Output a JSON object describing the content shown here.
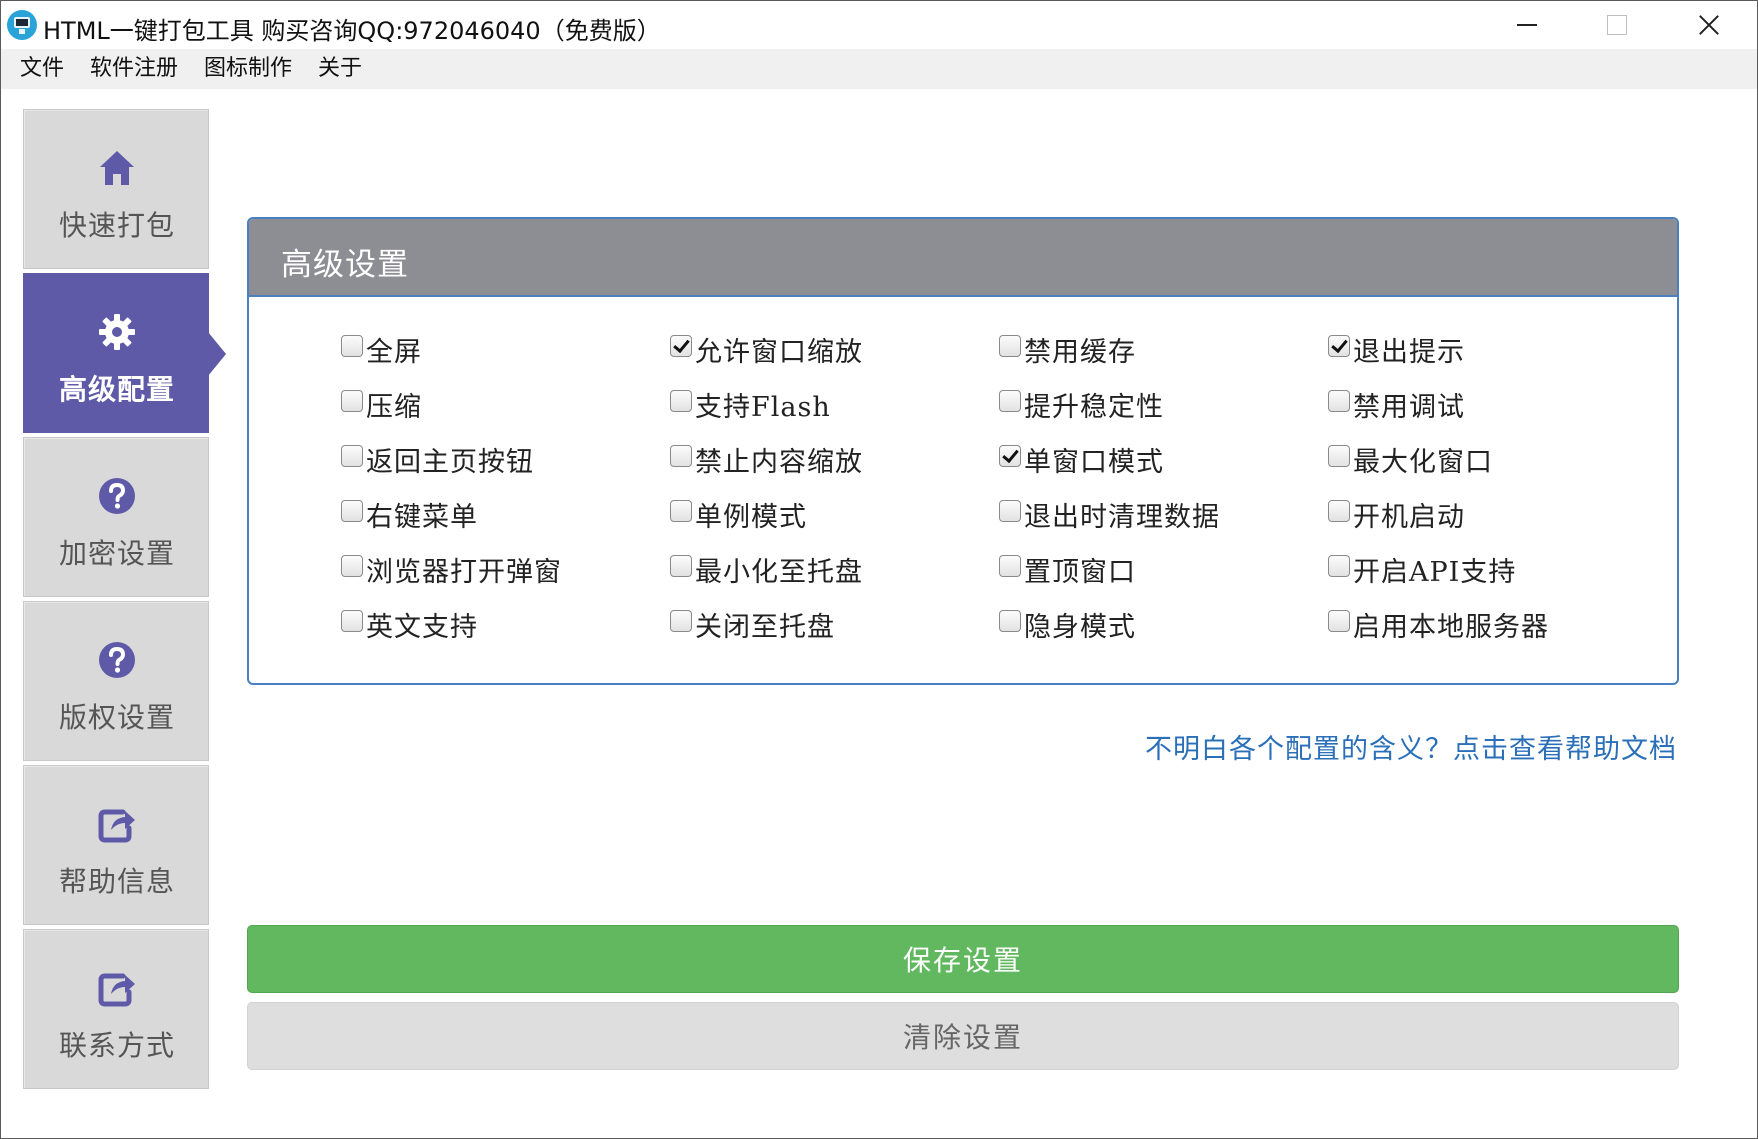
{
  "window": {
    "title": "HTML一键打包工具 购买咨询QQ:972046040（免费版）"
  },
  "menu": [
    "文件",
    "软件注册",
    "图标制作",
    "关于"
  ],
  "sidebar": {
    "items": [
      {
        "label": "快速打包",
        "icon": "home-icon",
        "active": false
      },
      {
        "label": "高级配置",
        "icon": "gear-icon",
        "active": true
      },
      {
        "label": "加密设置",
        "icon": "question-circle-icon",
        "active": false
      },
      {
        "label": "版权设置",
        "icon": "question-circle-icon",
        "active": false
      },
      {
        "label": "帮助信息",
        "icon": "share-icon",
        "active": false
      },
      {
        "label": "联系方式",
        "icon": "share-icon",
        "active": false
      }
    ]
  },
  "panel": {
    "title": "高级设置",
    "options": [
      [
        {
          "label": "全屏",
          "checked": false
        },
        {
          "label": "允许窗口缩放",
          "checked": true
        },
        {
          "label": "禁用缓存",
          "checked": false
        },
        {
          "label": "退出提示",
          "checked": true
        }
      ],
      [
        {
          "label": "压缩",
          "checked": false
        },
        {
          "label": "支持Flash",
          "checked": false
        },
        {
          "label": "提升稳定性",
          "checked": false
        },
        {
          "label": "禁用调试",
          "checked": false
        }
      ],
      [
        {
          "label": "返回主页按钮",
          "checked": false
        },
        {
          "label": "禁止内容缩放",
          "checked": false
        },
        {
          "label": "单窗口模式",
          "checked": true
        },
        {
          "label": "最大化窗口",
          "checked": false
        }
      ],
      [
        {
          "label": "右键菜单",
          "checked": false
        },
        {
          "label": "单例模式",
          "checked": false
        },
        {
          "label": "退出时清理数据",
          "checked": false
        },
        {
          "label": "开机启动",
          "checked": false
        }
      ],
      [
        {
          "label": "浏览器打开弹窗",
          "checked": false
        },
        {
          "label": "最小化至托盘",
          "checked": false
        },
        {
          "label": "置顶窗口",
          "checked": false
        },
        {
          "label": "开启API支持",
          "checked": false
        }
      ],
      [
        {
          "label": "英文支持",
          "checked": false
        },
        {
          "label": "关闭至托盘",
          "checked": false
        },
        {
          "label": "隐身模式",
          "checked": false
        },
        {
          "label": "启用本地服务器",
          "checked": false
        }
      ]
    ]
  },
  "help_link": "不明白各个配置的含义？点击查看帮助文档",
  "buttons": {
    "save": "保存设置",
    "clear": "清除设置"
  },
  "colors": {
    "accent": "#5e5aa8",
    "panel_header": "#8d8d94",
    "panel_border": "#4a7fc1",
    "save": "#62b85e",
    "link": "#2a6fb8"
  }
}
